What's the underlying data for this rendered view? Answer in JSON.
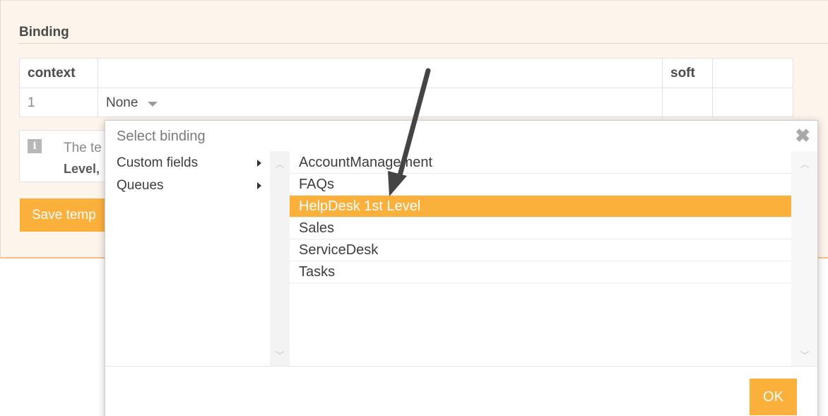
{
  "panel": {
    "title": "Binding"
  },
  "binding_table": {
    "headers": [
      "context",
      "",
      "soft",
      ""
    ],
    "row": {
      "context": "1",
      "value": "None"
    }
  },
  "info": {
    "line1": "The te",
    "line2": "Level,"
  },
  "save_button": "Save temp",
  "dialog": {
    "title": "Select binding",
    "close_icon": "close-icon",
    "categories": [
      {
        "label": "Custom fields"
      },
      {
        "label": "Queues"
      }
    ],
    "items": [
      {
        "label": "AccountManagement",
        "selected": false
      },
      {
        "label": "FAQs",
        "selected": false
      },
      {
        "label": "HelpDesk 1st Level",
        "selected": true
      },
      {
        "label": "Sales",
        "selected": false
      },
      {
        "label": "ServiceDesk",
        "selected": false
      },
      {
        "label": "Tasks",
        "selected": false
      }
    ],
    "ok_label": "OK"
  },
  "colors": {
    "accent": "#fbb03b",
    "panel_bg": "#fdf5ec",
    "annotation_arrow": "#444444"
  }
}
